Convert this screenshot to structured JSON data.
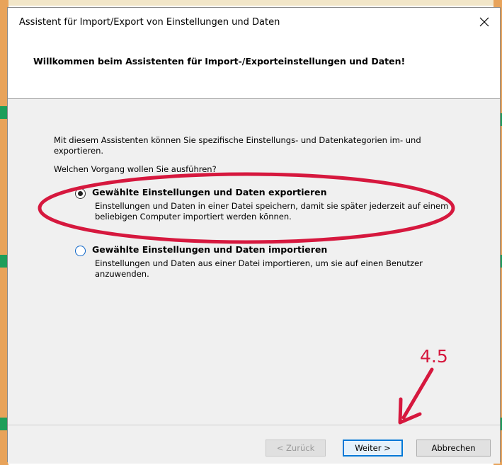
{
  "window": {
    "title": "Assistent für Import/Export von Einstellungen und Daten"
  },
  "header": {
    "title": "Willkommen beim Assistenten für Import-/Exporteinstellungen und Daten!"
  },
  "content": {
    "intro": "Mit diesem Assistenten können Sie spezifische Einstellungs- und Datenkategorien im- und exportieren.",
    "question": "Welchen Vorgang wollen Sie ausführen?",
    "options": [
      {
        "label": "Gewählte Einstellungen und Daten exportieren",
        "description": "Einstellungen und Daten in einer Datei speichern, damit sie später jederzeit auf einem beliebigen Computer importiert werden können.",
        "selected": true
      },
      {
        "label": "Gewählte Einstellungen und Daten importieren",
        "description": "Einstellungen und Daten aus einer Datei importieren, um sie auf einen Benutzer anzuwenden.",
        "selected": false
      }
    ]
  },
  "footer": {
    "back_label": "< Zurück",
    "next_label": "Weiter >",
    "cancel_label": "Abbrechen"
  },
  "annotation": {
    "step_label": "4.5",
    "color": "#d6183e"
  }
}
